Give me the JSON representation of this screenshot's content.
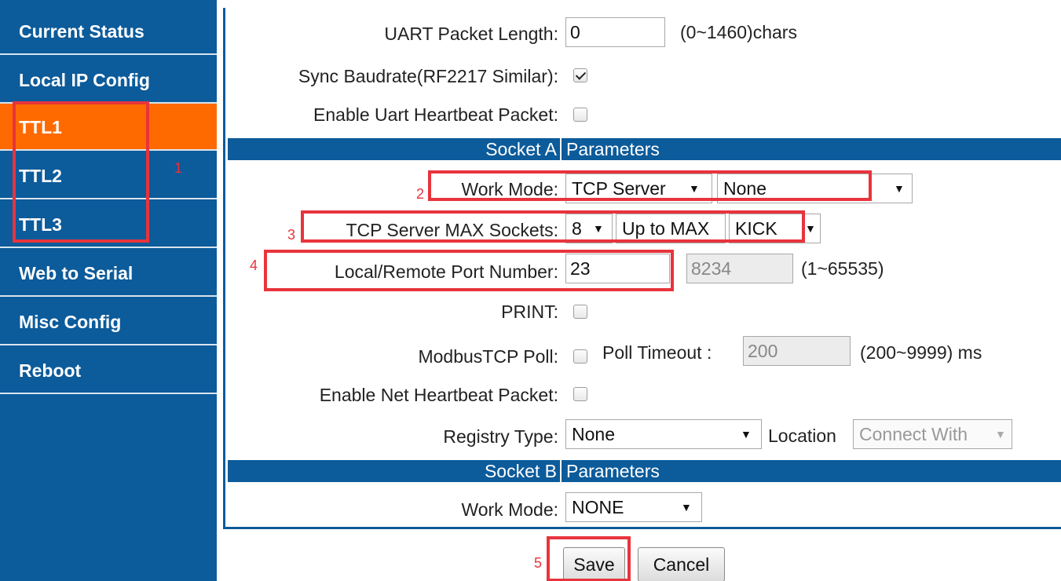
{
  "sidebar": {
    "items": [
      {
        "label": "Current Status"
      },
      {
        "label": "Local IP Config"
      },
      {
        "label": "TTL1"
      },
      {
        "label": "TTL2"
      },
      {
        "label": "TTL3"
      },
      {
        "label": "Web to Serial"
      },
      {
        "label": "Misc Config"
      },
      {
        "label": "Reboot"
      }
    ],
    "active_item": "TTL1"
  },
  "uart": {
    "packet_length_label": "UART Packet Length:",
    "packet_length_value": "0",
    "packet_length_hint": "(0~1460)chars",
    "sync_baudrate_label": "Sync Baudrate(RF2217 Similar):",
    "sync_baudrate_checked": true,
    "heartbeat_label": "Enable Uart Heartbeat Packet:",
    "heartbeat_checked": false
  },
  "socket_a": {
    "header_left": "Socket A",
    "header_right": "Parameters",
    "work_mode_label": "Work Mode:",
    "work_mode_value": "TCP Server",
    "work_mode_sub_value": "None",
    "max_sockets_label": "TCP Server MAX Sockets:",
    "max_sockets_value": "8",
    "up_to_max_label": "Up to MAX",
    "kick_value": "KICK",
    "port_label": "Local/Remote Port Number:",
    "local_port_value": "23",
    "remote_port_value": "8234",
    "port_hint": "(1~65535)",
    "print_label": "PRINT:",
    "print_checked": false,
    "modbus_label": "ModbusTCP Poll:",
    "modbus_checked": false,
    "poll_timeout_label": "Poll Timeout :",
    "poll_timeout_value": "200",
    "poll_timeout_hint": "(200~9999) ms",
    "net_heartbeat_label": "Enable Net Heartbeat Packet:",
    "net_heartbeat_checked": false,
    "registry_label": "Registry Type:",
    "registry_value": "None",
    "location_label": "Location",
    "location_value": "Connect With"
  },
  "socket_b": {
    "header_left": "Socket B",
    "header_right": "Parameters",
    "work_mode_label": "Work Mode:",
    "work_mode_value": "NONE"
  },
  "actions": {
    "save_label": "Save",
    "cancel_label": "Cancel"
  },
  "annotations": {
    "n1": "1",
    "n2": "2",
    "n3": "3",
    "n4": "4",
    "n5": "5",
    "color": "#e8343c"
  },
  "colors": {
    "brand_blue": "#0c5b9a",
    "active_orange": "#ff6a00"
  },
  "icons": {
    "dropdown": "dropdown-arrow-icon",
    "checkbox": "checkbox-icon"
  }
}
